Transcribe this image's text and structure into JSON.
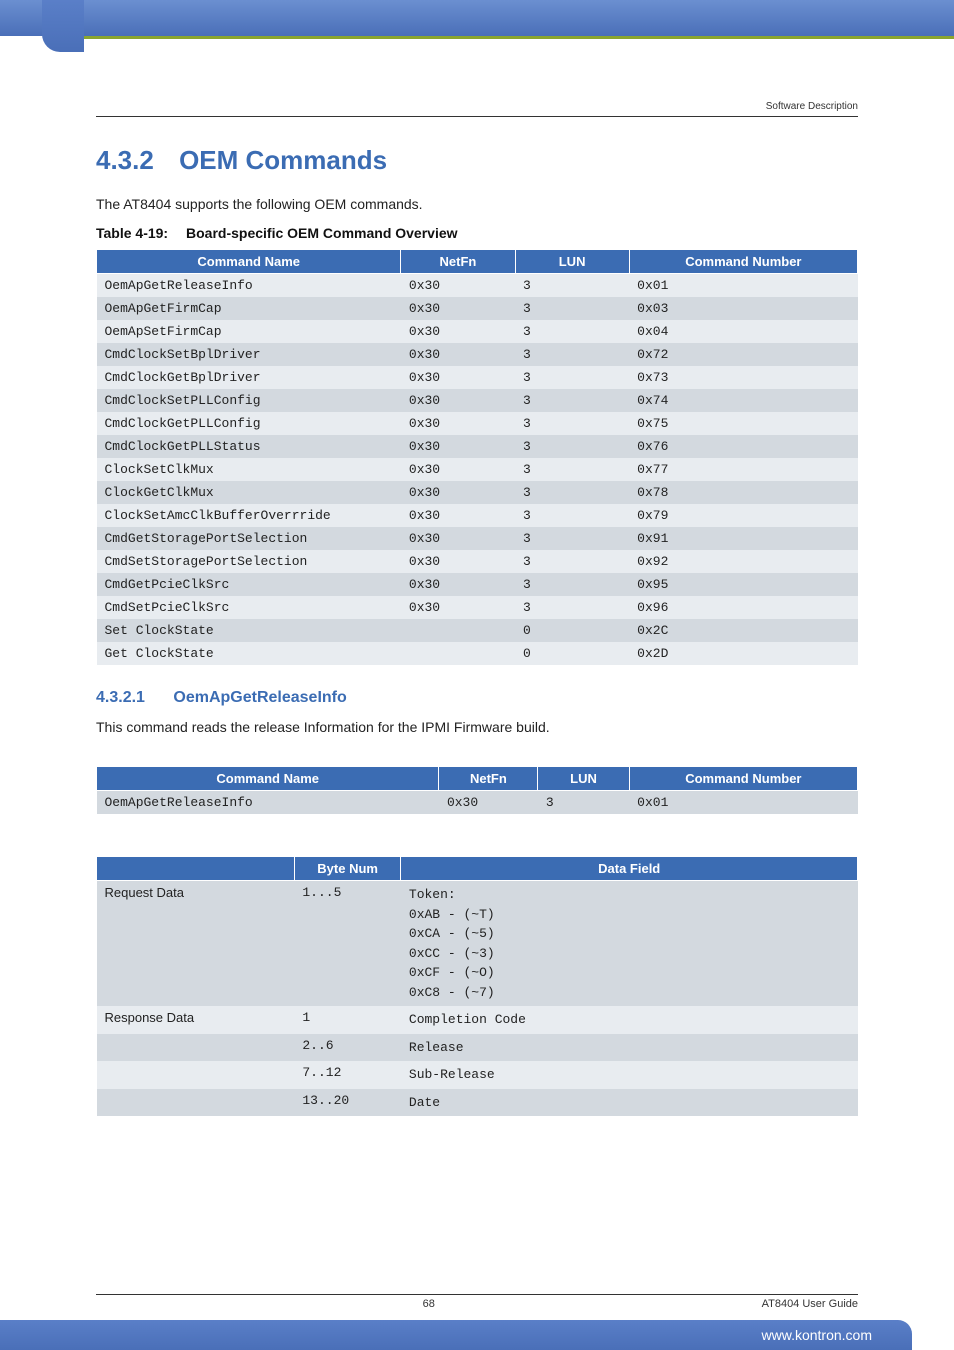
{
  "header": {
    "right": "Software Description"
  },
  "section": {
    "number": "4.3.2",
    "title": "OEM Commands"
  },
  "intro": "The AT8404 supports the following OEM commands.",
  "table1": {
    "caption_num": "Table 4-19:",
    "caption_text": "Board-specific OEM Command Overview",
    "headers": [
      "Command Name",
      "NetFn",
      "LUN",
      "Command Number"
    ],
    "rows": [
      {
        "name": "OemApGetReleaseInfo",
        "netfn": "0x30",
        "lun": "3",
        "cmd": "0x01"
      },
      {
        "name": "OemApGetFirmCap",
        "netfn": "0x30",
        "lun": "3",
        "cmd": "0x03"
      },
      {
        "name": "OemApSetFirmCap",
        "netfn": "0x30",
        "lun": "3",
        "cmd": "0x04"
      },
      {
        "name": "CmdClockSetBplDriver",
        "netfn": "0x30",
        "lun": "3",
        "cmd": "0x72"
      },
      {
        "name": "CmdClockGetBplDriver",
        "netfn": "0x30",
        "lun": "3",
        "cmd": "0x73"
      },
      {
        "name": "CmdClockSetPLLConfig",
        "netfn": "0x30",
        "lun": "3",
        "cmd": "0x74"
      },
      {
        "name": "CmdClockGetPLLConfig",
        "netfn": "0x30",
        "lun": "3",
        "cmd": "0x75"
      },
      {
        "name": "CmdClockGetPLLStatus",
        "netfn": "0x30",
        "lun": "3",
        "cmd": "0x76"
      },
      {
        "name": "ClockSetClkMux",
        "netfn": "0x30",
        "lun": "3",
        "cmd": "0x77"
      },
      {
        "name": "ClockGetClkMux",
        "netfn": "0x30",
        "lun": "3",
        "cmd": "0x78"
      },
      {
        "name": "ClockSetAmcClkBufferOverrride",
        "netfn": "0x30",
        "lun": "3",
        "cmd": "0x79"
      },
      {
        "name": "CmdGetStoragePortSelection",
        "netfn": "0x30",
        "lun": "3",
        "cmd": "0x91"
      },
      {
        "name": "CmdSetStoragePortSelection",
        "netfn": "0x30",
        "lun": "3",
        "cmd": "0x92"
      },
      {
        "name": "CmdGetPcieClkSrc",
        "netfn": "0x30",
        "lun": "3",
        "cmd": "0x95"
      },
      {
        "name": "CmdSetPcieClkSrc",
        "netfn": "0x30",
        "lun": "3",
        "cmd": "0x96"
      },
      {
        "name": "Set ClockState",
        "netfn": "",
        "lun": "0",
        "cmd": "0x2C"
      },
      {
        "name": "Get ClockState",
        "netfn": "",
        "lun": "0",
        "cmd": "0x2D"
      }
    ]
  },
  "subsection": {
    "number": "4.3.2.1",
    "title": "OemApGetReleaseInfo"
  },
  "sub_intro": "This command reads the release Information for the IPMI Firmware build.",
  "table2": {
    "headers": [
      "Command Name",
      "NetFn",
      "LUN",
      "Command Number"
    ],
    "row": {
      "name": "OemApGetReleaseInfo",
      "netfn": "0x30",
      "lun": "3",
      "cmd": "0x01"
    }
  },
  "table3": {
    "headers": [
      "",
      "Byte Num",
      "Data Field"
    ],
    "rows": [
      {
        "label": "Request Data",
        "byte": "1...5",
        "data": "Token:\n0xAB - (~T)\n0xCA - (~5)\n0xCC - (~3)\n0xCF - (~O)\n0xC8 - (~7)"
      },
      {
        "label": "Response Data",
        "byte": "1",
        "data": "Completion Code"
      },
      {
        "label": "",
        "byte": "2..6",
        "data": "Release"
      },
      {
        "label": "",
        "byte": "7..12",
        "data": "Sub-Release"
      },
      {
        "label": "",
        "byte": "13..20",
        "data": "Date"
      }
    ]
  },
  "footer": {
    "page": "68",
    "doc": "AT8404 User  Guide",
    "url": "www.kontron.com"
  }
}
